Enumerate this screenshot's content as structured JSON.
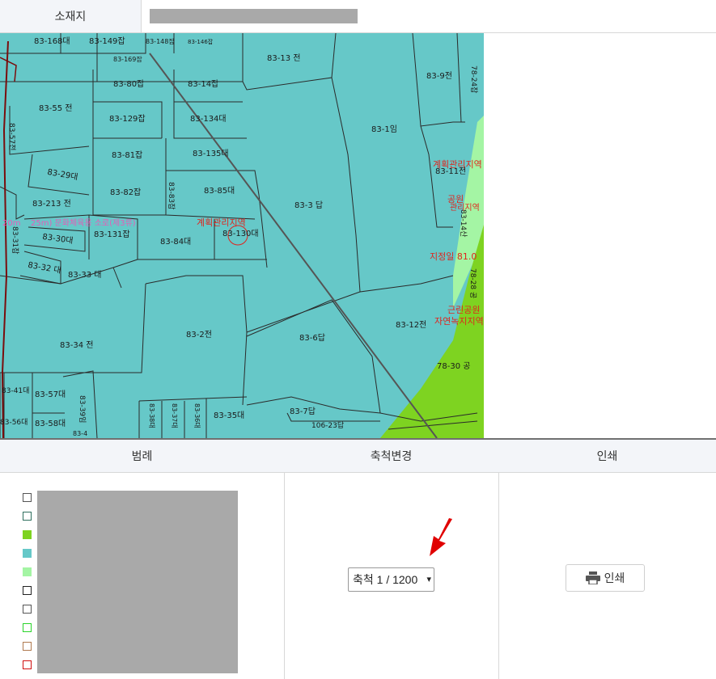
{
  "location": {
    "label": "소재지"
  },
  "headers": {
    "legend": "범례",
    "scale": "축척변경",
    "print": "인쇄"
  },
  "scale": {
    "selected": "축척 1 / 1200"
  },
  "print_button": {
    "label": "인쇄"
  },
  "map": {
    "parcels": [
      "83-168대",
      "83-149잡",
      "83-148잡",
      "83-146잡",
      "83-13 전",
      "83-169잡",
      "83-80잡",
      "83-14잡",
      "83-9전",
      "78-24잡",
      "83-55 전",
      "83-129잡",
      "83-134대",
      "83-1임",
      "83-57전",
      "83-81잡",
      "83-135대",
      "83-29대",
      "83-11전",
      "83-82잡",
      "83-83잡",
      "83-85대",
      "83-213 전",
      "83-3 답",
      "83-14산",
      "83-131잡",
      "83-84대",
      "83-130대",
      "83-30대",
      "83-31잡",
      "83-32 대",
      "83-33 대",
      "78-28 공",
      "83-12전",
      "83-6답",
      "83-34 전",
      "83-2전",
      "78-30 공",
      "83-41대",
      "83-57대",
      "83-39임",
      "83-38대",
      "83-37대",
      "83-36대",
      "83-35대",
      "83-7답",
      "83-56대",
      "83-58대",
      "106-23답",
      "83-4"
    ],
    "zone_labels": [
      "계획관리지역",
      "공원",
      "관리지역",
      "지정일 81.0",
      "근린공원",
      "자연녹지지역",
      "25m) 문화체육용 소로(제3류)",
      "계획관리지역",
      "20m"
    ]
  },
  "colors": {
    "map_bg": "#66c8c8",
    "green": "#7ed321",
    "light_green": "#a4f5a4",
    "red_label": "#e0241d",
    "pink_label": "#e45db7",
    "arrow": "#e00000"
  },
  "legend_swatches": [
    "#ffffff",
    "#ffffff",
    "#7ed321",
    "#66c8c8",
    "#a4f5a4",
    "#ffffff",
    "#ffffff",
    "#ffffff",
    "#ffffff",
    "#ffffff"
  ]
}
